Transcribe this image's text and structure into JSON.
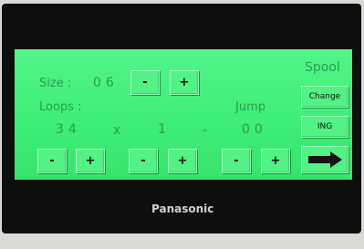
{
  "screen": {
    "title": "Spool",
    "size_label": "Size :",
    "size_value": "06",
    "loops_label": "Loops :",
    "loops_value": "34",
    "times_sign": "x",
    "multiplier_value": "1",
    "dash_sign": "-",
    "jump_label": "Jump",
    "jump_value": "00",
    "minus_label": "-",
    "plus_label": "+",
    "change_label": "Change",
    "ing_label": "ING"
  },
  "device": {
    "brand": "Panasonic"
  },
  "colors": {
    "screen_bg": "#41f07b",
    "label_text": "#2a9a4e",
    "bezel": "#0d0e0e"
  },
  "icons": {
    "next_button": "right-arrow-icon"
  }
}
